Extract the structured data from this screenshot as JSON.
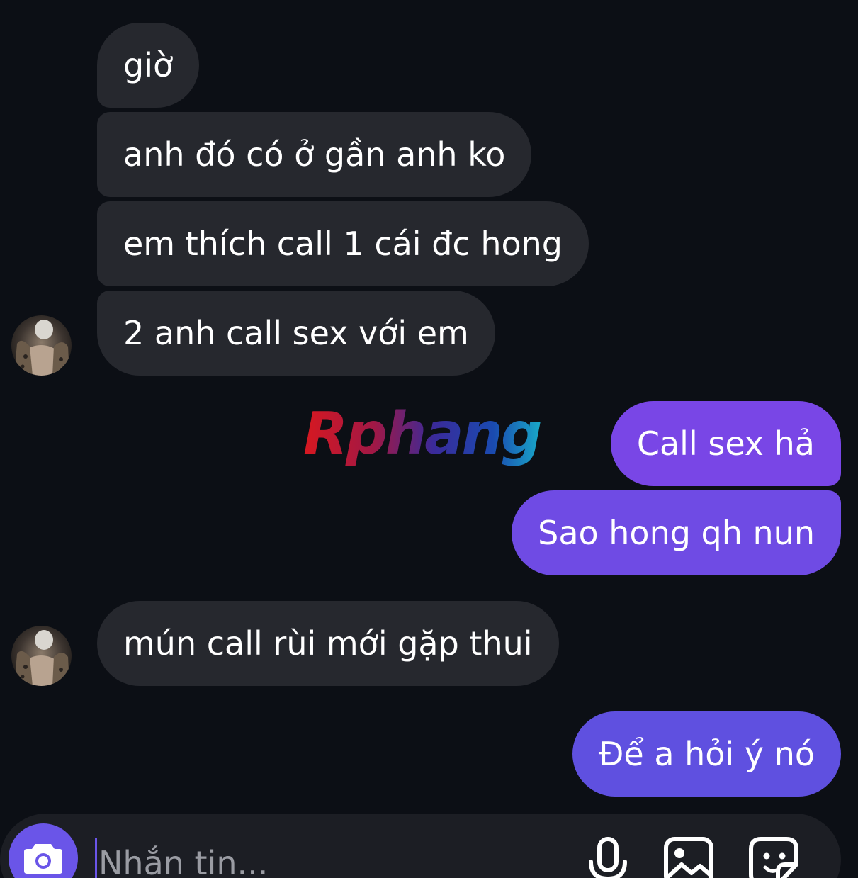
{
  "messages": [
    {
      "from": "other",
      "text": "giờ"
    },
    {
      "from": "other",
      "text": "anh đó có ở gần anh ko"
    },
    {
      "from": "other",
      "text": "em thích call 1 cái đc hong"
    },
    {
      "from": "other",
      "text": "2 anh call sex với em"
    },
    {
      "from": "me",
      "text": "Call sex hả"
    },
    {
      "from": "me",
      "text": "Sao hong qh nun"
    },
    {
      "from": "other",
      "text": "mún call rùi mới gặp thui"
    },
    {
      "from": "me",
      "text": "Để a hỏi ý nó"
    }
  ],
  "watermark": {
    "text": "Rphang"
  },
  "composer": {
    "placeholder": "Nhắn tin...",
    "value": "",
    "icons": [
      "camera-icon",
      "microphone-icon",
      "image-icon",
      "sticker-icon"
    ]
  },
  "colors": {
    "background": "#0c0f15",
    "received_bubble": "#26282e",
    "sent_bubble_top": "#7a45e6",
    "sent_bubble_bottom": "#5f50e0",
    "accent": "#6a55e8"
  }
}
